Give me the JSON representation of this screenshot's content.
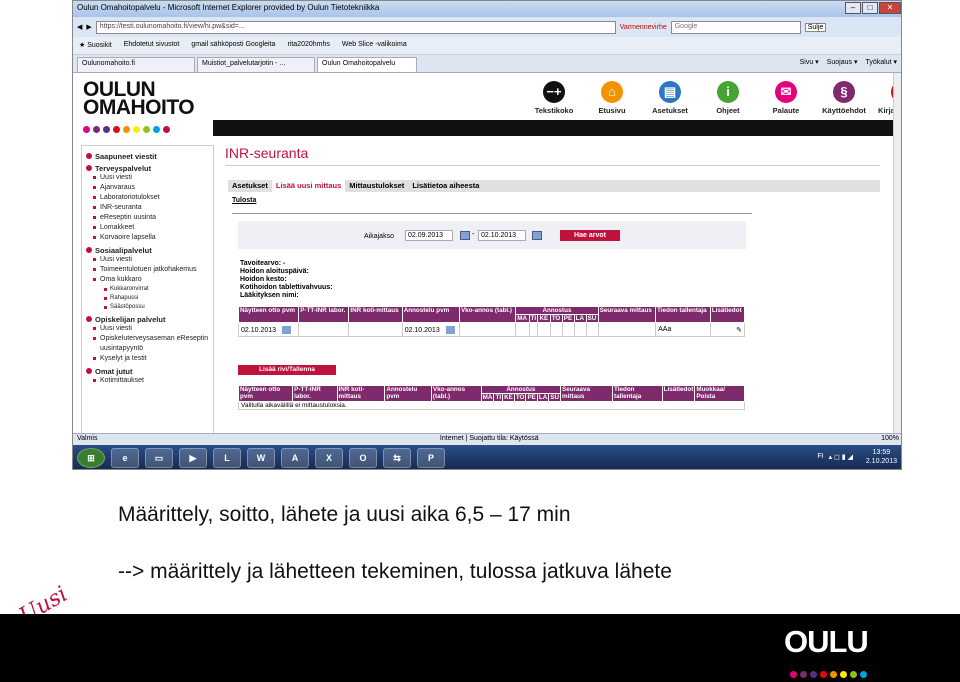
{
  "browser": {
    "title": "Oulun Omahoitopalvelu - Microsoft Internet Explorer provided by Oulun Tietotekniikka",
    "close_label": "Sulje",
    "url": "https://testi.oulunomahoito.fi/view/hi.pw&sid=...",
    "cert_label": "Varmennevirhe",
    "search_placeholder": "Google",
    "favorites": [
      "Suosikit",
      "Ehdotetut sivustot",
      "gmail sähköposti Googleita",
      "rita2020hmhs",
      "Web Slice -valikoima"
    ],
    "tabs": [
      "Oulunomahoito.fi",
      "Muistiot_palvelutarjotin - ...",
      "Oulun Omahoitopalvelu"
    ],
    "tools": [
      "Sivu",
      "Suojaus",
      "Työkalut"
    ],
    "status_left": "Valmis",
    "status_zone": "Internet | Suojattu tila: Käytössä",
    "zoom": "100%"
  },
  "site": {
    "logo_line1": "OULUN",
    "logo_line2": "OMAHOITO",
    "brand_dots": [
      "#e4007c",
      "#7e2a6c",
      "#5a2d8a",
      "#e30613",
      "#f39200",
      "#ffed00",
      "#95c11f",
      "#00a0e3",
      "#c0123c"
    ],
    "top_icons": [
      {
        "label": "Tekstikoko",
        "icon": "text-size-icon",
        "glyph": "−+",
        "color": "#111111"
      },
      {
        "label": "Etusivu",
        "icon": "home-icon",
        "glyph": "⌂",
        "color": "#f39200"
      },
      {
        "label": "Asetukset",
        "icon": "settings-icon",
        "glyph": "▤",
        "color": "#2a78c2"
      },
      {
        "label": "Ohjeet",
        "icon": "info-icon",
        "glyph": "i",
        "color": "#46a435"
      },
      {
        "label": "Palaute",
        "icon": "mail-icon",
        "glyph": "✉",
        "color": "#e4007c"
      },
      {
        "label": "Käyttöehdot",
        "icon": "paragraph-icon",
        "glyph": "§",
        "color": "#7e2a6c"
      },
      {
        "label": "Kirjaudu ulos",
        "icon": "logout-icon",
        "glyph": "✕",
        "color": "#e30613"
      }
    ]
  },
  "sidebar": [
    {
      "type": "h",
      "label": "Saapuneet viestit"
    },
    {
      "type": "h",
      "label": "Terveyspalvelut"
    },
    {
      "type": "i",
      "label": "Uusi viesti"
    },
    {
      "type": "i",
      "label": "Ajanvaraus"
    },
    {
      "type": "i",
      "label": "Laboratoriotulokset"
    },
    {
      "type": "i",
      "label": "INR-seuranta"
    },
    {
      "type": "i",
      "label": "eReseptin uusinta"
    },
    {
      "type": "i",
      "label": "Lomakkeet"
    },
    {
      "type": "i",
      "label": "Korvaoire lapsella"
    },
    {
      "type": "h",
      "label": "Sosiaalipalvelut"
    },
    {
      "type": "i",
      "label": "Uusi viesti"
    },
    {
      "type": "i",
      "label": "Toimeentulotuen jatkohakemus"
    },
    {
      "type": "i",
      "label": "Oma kukkaro"
    },
    {
      "type": "ii",
      "label": "Kukkaronvirrat"
    },
    {
      "type": "ii",
      "label": "Rahapussi"
    },
    {
      "type": "ii",
      "label": "Säästöpossu"
    },
    {
      "type": "h",
      "label": "Opiskelijan palvelut"
    },
    {
      "type": "i",
      "label": "Uusi viesti"
    },
    {
      "type": "i",
      "label": "Opiskeluterveysaseman eReseptin uusintapyyntö"
    },
    {
      "type": "i",
      "label": "Kyselyt ja testit"
    },
    {
      "type": "h",
      "label": "Omat jutut"
    },
    {
      "type": "i",
      "label": "Kotimittaukset"
    }
  ],
  "main": {
    "title": "INR-seuranta",
    "tabs": [
      "Asetukset",
      "Lisää uusi mittaus",
      "Mittaustulokset",
      "Lisätietoa aiheesta"
    ],
    "active_tab": 1,
    "print_link": "Tulosta",
    "period_label": "Aikajakso",
    "date_from": "02.09.2013",
    "date_to": "02.10.2013",
    "search_button": "Hae arvot",
    "info_lines": [
      "Tavoitearvo: -",
      "Hoidon aloituspäivä:",
      "Hoidon kesto:",
      "Kotihoidon tablettivahvuus:",
      "Lääkityksen nimi:"
    ],
    "dose_header": "Annostus",
    "table1_headers": [
      "Näytteen otto pvm",
      "P-TT-INR labor.",
      "INR koti-mittaus",
      "Annostelu pvm",
      "Vko-annos (tabl.)",
      "MA",
      "TI",
      "KE",
      "TO",
      "PE",
      "LA",
      "SU",
      "Seuraava mittaus",
      "Tiedon tallentaja",
      "Lisätiedot"
    ],
    "row_sample_date": "02.10.2013",
    "row_dose_date": "02.10.2013",
    "row_saver": "AAa",
    "add_row_button": "Lisää rivi/Tallenna",
    "table2_headers": [
      "Näytteen otto pvm",
      "P-TT-INR labor.",
      "INR koti-mittaus",
      "Annostelu pvm",
      "Vko-annos (tabl.)",
      "MA",
      "TI",
      "KE",
      "TO",
      "PE",
      "LA",
      "SU",
      "Seuraava mittaus",
      "Tiedon tallentaja",
      "Lisätiedot",
      "Muokkaa/ Poista"
    ],
    "empty_message": "Valitulla aikavälillä ei mittaustuloksia."
  },
  "taskbar": {
    "apps": [
      "start",
      "ie",
      "explorer",
      "media",
      "lync",
      "word",
      "pdf",
      "excel",
      "outlook",
      "network",
      "powerpoint"
    ],
    "lang": "FI",
    "time": "13:59",
    "date": "2.10.2013"
  },
  "slide": {
    "line1": "Määrittely, soitto, lähete ja uusi aika 6,5 – 17 min",
    "line2": "-->  määrittely ja lähetteen tekeminen, tulossa jatkuva lähete",
    "corner_text": "Uusi",
    "footer_logo": "OULU",
    "footer_dots": [
      "#e4007c",
      "#7e2a6c",
      "#5a2d8a",
      "#e30613",
      "#f39200",
      "#ffed00",
      "#95c11f",
      "#00a0e3"
    ]
  }
}
